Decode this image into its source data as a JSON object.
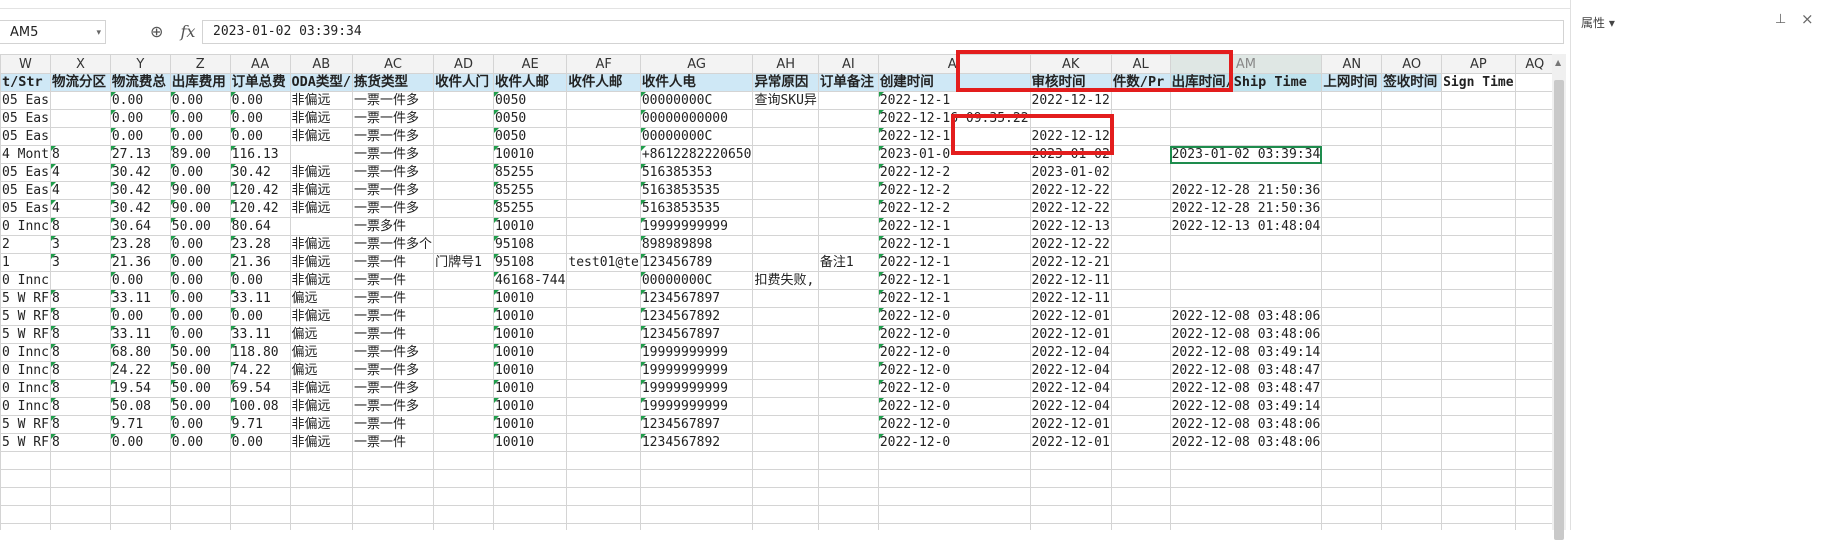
{
  "namebox": {
    "value": "AM5",
    "caret": "▾"
  },
  "formula_bar": {
    "zoom_icon": "⊕",
    "fx_label": "fx",
    "value": "2023-01-02 03:39:34"
  },
  "panel": {
    "title": "属性 ▾",
    "pin": "⊥",
    "close": "×"
  },
  "sheet": {
    "columns": [
      {
        "label": "W"
      },
      {
        "label": "X"
      },
      {
        "label": "Y"
      },
      {
        "label": "Z"
      },
      {
        "label": "AA"
      },
      {
        "label": "AB"
      },
      {
        "label": "AC"
      },
      {
        "label": "AD"
      },
      {
        "label": "AE"
      },
      {
        "label": "AF"
      },
      {
        "label": "AG"
      },
      {
        "label": "AH"
      },
      {
        "label": "AI"
      },
      {
        "label": "AJ"
      },
      {
        "label": "AK"
      },
      {
        "label": "AL"
      },
      {
        "label": "AM"
      },
      {
        "label": "AN"
      },
      {
        "label": "AO"
      },
      {
        "label": "AP"
      },
      {
        "label": "AQ"
      }
    ],
    "header_row": [
      "t/Str",
      "物流分区",
      "物流费总",
      "出库费用",
      "订单总费",
      "ODA类型/",
      "拣货类型",
      "收件人门",
      "收件人邮",
      "收件人邮",
      "收件人电",
      "异常原因",
      "订单备注",
      "创建时间",
      "审核时间",
      "件数/Pr",
      "出库时间/Ship Time",
      "上网时间",
      "签收时间",
      "Sign Time",
      ""
    ],
    "rows": [
      [
        "05 Eas",
        "",
        "0.00",
        "0.00",
        "0.00",
        "非偏远",
        "一票一件多",
        "",
        "0050",
        "",
        "00000000C",
        "查询SKU异",
        "",
        "2022-12-1",
        "2022-12-12",
        "",
        "",
        "",
        "",
        "",
        ""
      ],
      [
        "05 Eas",
        "",
        "0.00",
        "0.00",
        "0.00",
        "非偏远",
        "一票一件多",
        "",
        "0050",
        "",
        "00000000000",
        "",
        "",
        "2022-12-16 09:35:22",
        "",
        "",
        "",
        "",
        "",
        "",
        ""
      ],
      [
        "05 Eas",
        "",
        "0.00",
        "0.00",
        "0.00",
        "非偏远",
        "一票一件多",
        "",
        "0050",
        "",
        "00000000C",
        "",
        "",
        "2022-12-1",
        "2022-12-12",
        "",
        "",
        "",
        "",
        "",
        ""
      ],
      [
        "4 Mont",
        "8",
        "27.13",
        "89.00",
        "116.13",
        "",
        "一票一件多",
        "",
        "10010",
        "",
        "+8612282220650",
        "",
        "",
        "2023-01-0",
        "2023-01-02",
        "",
        "2023-01-02 03:39:34",
        "",
        "",
        "",
        ""
      ],
      [
        "05 Eas",
        "4",
        "30.42",
        "0.00",
        "30.42",
        "非偏远",
        "一票一件多",
        "",
        "85255",
        "",
        "516385353",
        "",
        "",
        "2022-12-2",
        "2023-01-02",
        "",
        "",
        "",
        "",
        "",
        ""
      ],
      [
        "05 Eas",
        "4",
        "30.42",
        "90.00",
        "120.42",
        "非偏远",
        "一票一件多",
        "",
        "85255",
        "",
        "5163853535",
        "",
        "",
        "2022-12-2",
        "2022-12-22",
        "",
        "2022-12-28 21:50:36",
        "",
        "",
        "",
        ""
      ],
      [
        "05 Eas",
        "4",
        "30.42",
        "90.00",
        "120.42",
        "非偏远",
        "一票一件多",
        "",
        "85255",
        "",
        "5163853535",
        "",
        "",
        "2022-12-2",
        "2022-12-22",
        "",
        "2022-12-28 21:50:36",
        "",
        "",
        "",
        ""
      ],
      [
        "0 Innc",
        "8",
        "30.64",
        "50.00",
        "80.64",
        "",
        "一票多件",
        "",
        "10010",
        "",
        "19999999999",
        "",
        "",
        "2022-12-1",
        "2022-12-13",
        "",
        "2022-12-13 01:48:04",
        "",
        "",
        "",
        ""
      ],
      [
        "2",
        "3",
        "23.28",
        "0.00",
        "23.28",
        "非偏远",
        "一票一件多个",
        "",
        "95108",
        "",
        "898989898",
        "",
        "",
        "2022-12-1",
        "2022-12-22",
        "",
        "",
        "",
        "",
        "",
        ""
      ],
      [
        "1",
        "3",
        "21.36",
        "0.00",
        "21.36",
        "非偏远",
        "一票一件",
        "门牌号1",
        "95108",
        "test01@te",
        "123456789",
        "",
        "备注1",
        "2022-12-1",
        "2022-12-21",
        "",
        "",
        "",
        "",
        "",
        ""
      ],
      [
        "0 Innc",
        "",
        "0.00",
        "0.00",
        "0.00",
        "非偏远",
        "一票一件",
        "",
        "46168-744",
        "",
        "00000000C",
        "扣费失败,",
        "",
        "2022-12-1",
        "2022-12-11",
        "",
        "",
        "",
        "",
        "",
        ""
      ],
      [
        "5 W RF",
        "8",
        "33.11",
        "0.00",
        "33.11",
        "偏远",
        "一票一件",
        "",
        "10010",
        "",
        "1234567897",
        "",
        "",
        "2022-12-1",
        "2022-12-11",
        "",
        "",
        "",
        "",
        "",
        ""
      ],
      [
        "5 W RF",
        "8",
        "0.00",
        "0.00",
        "0.00",
        "非偏远",
        "一票一件",
        "",
        "10010",
        "",
        "1234567892",
        "",
        "",
        "2022-12-0",
        "2022-12-01",
        "",
        "2022-12-08 03:48:06",
        "",
        "",
        "",
        ""
      ],
      [
        "5 W RF",
        "8",
        "33.11",
        "0.00",
        "33.11",
        "偏远",
        "一票一件",
        "",
        "10010",
        "",
        "1234567897",
        "",
        "",
        "2022-12-0",
        "2022-12-01",
        "",
        "2022-12-08 03:48:06",
        "",
        "",
        "",
        ""
      ],
      [
        "0 Innc",
        "8",
        "68.80",
        "50.00",
        "118.80",
        "偏远",
        "一票一件多",
        "",
        "10010",
        "",
        "19999999999",
        "",
        "",
        "2022-12-0",
        "2022-12-04",
        "",
        "2022-12-08 03:49:14",
        "",
        "",
        "",
        ""
      ],
      [
        "0 Innc",
        "8",
        "24.22",
        "50.00",
        "74.22",
        "偏远",
        "一票一件多",
        "",
        "10010",
        "",
        "19999999999",
        "",
        "",
        "2022-12-0",
        "2022-12-04",
        "",
        "2022-12-08 03:48:47",
        "",
        "",
        "",
        ""
      ],
      [
        "0 Innc",
        "8",
        "19.54",
        "50.00",
        "69.54",
        "非偏远",
        "一票一件多",
        "",
        "10010",
        "",
        "19999999999",
        "",
        "",
        "2022-12-0",
        "2022-12-04",
        "",
        "2022-12-08 03:48:47",
        "",
        "",
        "",
        ""
      ],
      [
        "0 Innc",
        "8",
        "50.08",
        "50.00",
        "100.08",
        "非偏远",
        "一票一件多",
        "",
        "10010",
        "",
        "19999999999",
        "",
        "",
        "2022-12-0",
        "2022-12-04",
        "",
        "2022-12-08 03:49:14",
        "",
        "",
        "",
        ""
      ],
      [
        "5 W RF",
        "8",
        "9.71",
        "0.00",
        "9.71",
        "非偏远",
        "一票一件",
        "",
        "10010",
        "",
        "1234567897",
        "",
        "",
        "2022-12-0",
        "2022-12-01",
        "",
        "2022-12-08 03:48:06",
        "",
        "",
        "",
        ""
      ],
      [
        "5 W RF",
        "8",
        "0.00",
        "0.00",
        "0.00",
        "非偏远",
        "一票一件",
        "",
        "10010",
        "",
        "1234567892",
        "",
        "",
        "2022-12-0",
        "2022-12-01",
        "",
        "2022-12-08 03:48:06",
        "",
        "",
        "",
        ""
      ]
    ],
    "empty_rows": 5
  }
}
